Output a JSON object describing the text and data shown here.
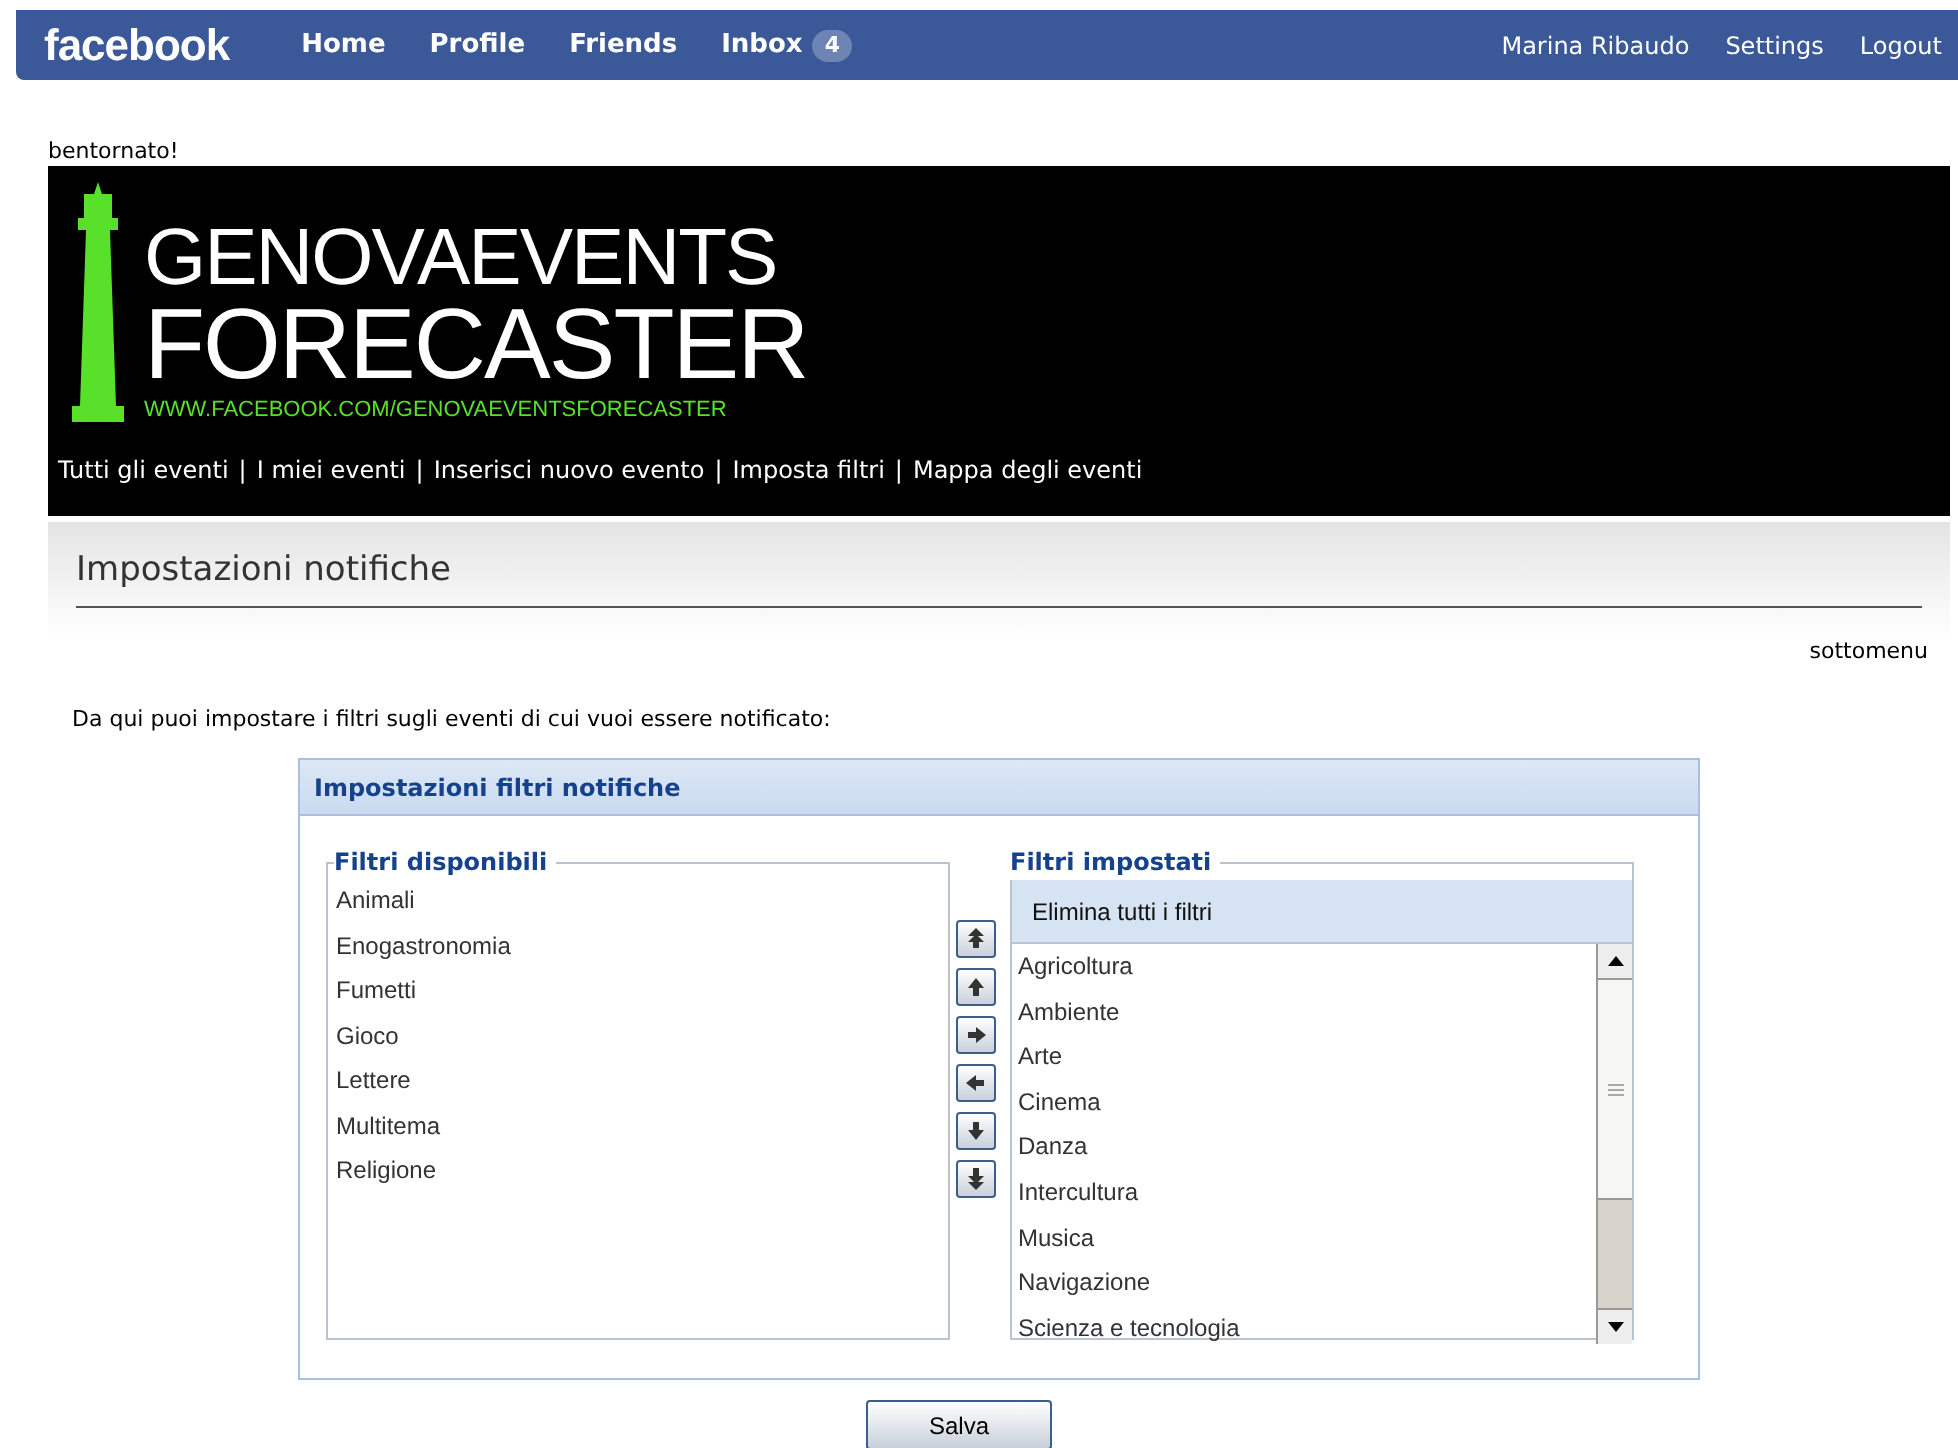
{
  "topbar": {
    "logo": "facebook",
    "nav": [
      {
        "label": "Home"
      },
      {
        "label": "Profile"
      },
      {
        "label": "Friends"
      },
      {
        "label": "Inbox",
        "badge": "4"
      }
    ],
    "right": [
      "Marina Ribaudo",
      "Settings",
      "Logout"
    ]
  },
  "greeting": "bentornato!",
  "banner": {
    "title_1": "GENOVAEVENTS",
    "title_2": "FORECASTER",
    "url": "WWW.FACEBOOK.COM/GENOVAEVENTSFORECASTER",
    "menu": [
      "Tutti gli eventi",
      "I miei eventi",
      "Inserisci nuovo evento",
      "Imposta filtri",
      "Mappa degli eventi"
    ],
    "separator": "|"
  },
  "section": {
    "title": "Impostazioni notifiche",
    "submenu": "sottomenu"
  },
  "intro": "Da qui puoi impostare i filtri sugli eventi di cui vuoi essere notificato:",
  "panel": {
    "title": "Impostazioni filtri notifiche",
    "available": {
      "legend": "Filtri disponibili",
      "items": [
        "Animali",
        "Enogastronomia",
        "Fumetti",
        "Gioco",
        "Lettere",
        "Multitema",
        "Religione"
      ]
    },
    "transfer_buttons": [
      {
        "kind": "top"
      },
      {
        "kind": "up"
      },
      {
        "kind": "right"
      },
      {
        "kind": "left"
      },
      {
        "kind": "down"
      },
      {
        "kind": "bottom"
      }
    ],
    "selected": {
      "legend": "Filtri impostati",
      "clear_all": "Elimina tutti i filtri",
      "items": [
        "Agricoltura",
        "Ambiente",
        "Arte",
        "Cinema",
        "Danza",
        "Intercultura",
        "Musica",
        "Navigazione",
        "Scienza e tecnologia"
      ]
    }
  },
  "save_button": "Salva"
}
